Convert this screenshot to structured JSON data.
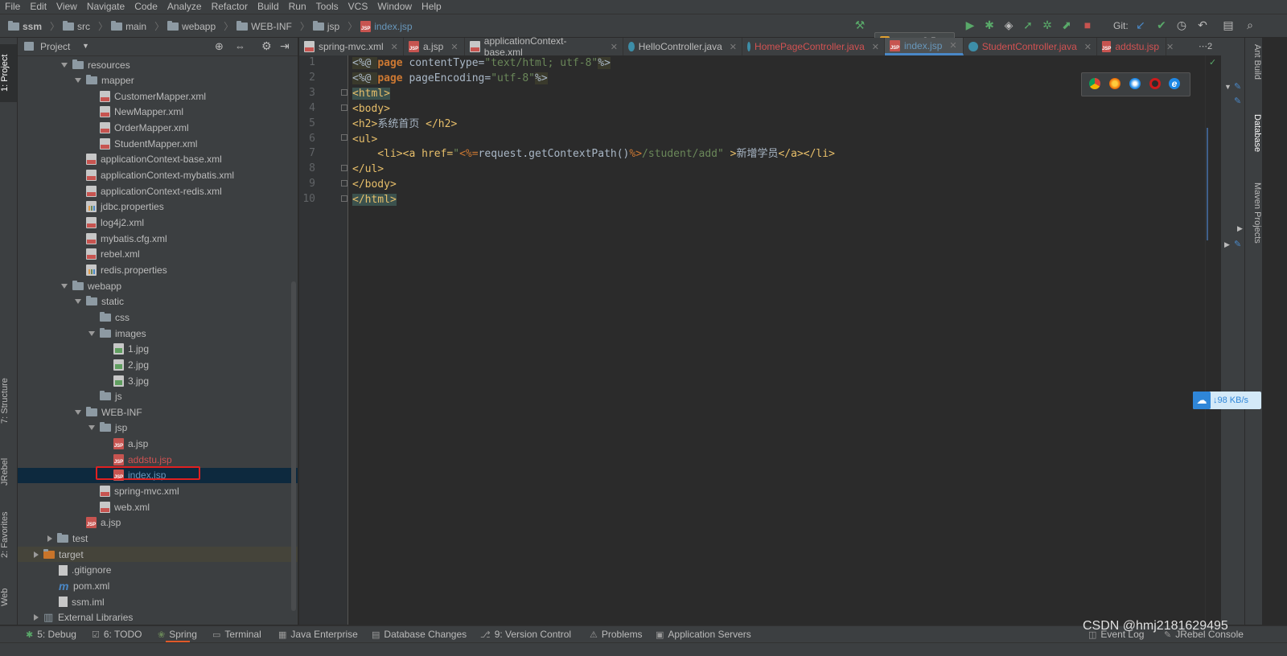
{
  "menu": [
    "File",
    "Edit",
    "View",
    "Navigate",
    "Code",
    "Analyze",
    "Refactor",
    "Build",
    "Run",
    "Tools",
    "VCS",
    "Window",
    "Help"
  ],
  "breadcrumb": [
    "ssm",
    "src",
    "main",
    "webapp",
    "WEB-INF",
    "jsp",
    "index.jsp"
  ],
  "toolbar": {
    "run_config": "tomcat8.5",
    "git_label": "Git:"
  },
  "project_panel": {
    "title": "Project"
  },
  "tree": [
    {
      "label": "resources",
      "depth": 2,
      "icon": "folder",
      "arrow": "down"
    },
    {
      "label": "mapper",
      "depth": 3,
      "icon": "folder",
      "arrow": "down"
    },
    {
      "label": "CustomerMapper.xml",
      "depth": 4,
      "icon": "xml"
    },
    {
      "label": "NewMapper.xml",
      "depth": 4,
      "icon": "xml"
    },
    {
      "label": "OrderMapper.xml",
      "depth": 4,
      "icon": "xml"
    },
    {
      "label": "StudentMapper.xml",
      "depth": 4,
      "icon": "xml"
    },
    {
      "label": "applicationContext-base.xml",
      "depth": 3,
      "icon": "xml"
    },
    {
      "label": "applicationContext-mybatis.xml",
      "depth": 3,
      "icon": "xml"
    },
    {
      "label": "applicationContext-redis.xml",
      "depth": 3,
      "icon": "xml"
    },
    {
      "label": "jdbc.properties",
      "depth": 3,
      "icon": "prop"
    },
    {
      "label": "log4j2.xml",
      "depth": 3,
      "icon": "xml"
    },
    {
      "label": "mybatis.cfg.xml",
      "depth": 3,
      "icon": "xml"
    },
    {
      "label": "rebel.xml",
      "depth": 3,
      "icon": "xml"
    },
    {
      "label": "redis.properties",
      "depth": 3,
      "icon": "prop"
    },
    {
      "label": "webapp",
      "depth": 2,
      "icon": "folder",
      "arrow": "down"
    },
    {
      "label": "static",
      "depth": 3,
      "icon": "folder",
      "arrow": "down"
    },
    {
      "label": "css",
      "depth": 4,
      "icon": "folder"
    },
    {
      "label": "images",
      "depth": 4,
      "icon": "folder",
      "arrow": "down"
    },
    {
      "label": "1.jpg",
      "depth": 5,
      "icon": "img"
    },
    {
      "label": "2.jpg",
      "depth": 5,
      "icon": "img"
    },
    {
      "label": "3.jpg",
      "depth": 5,
      "icon": "img"
    },
    {
      "label": "js",
      "depth": 4,
      "icon": "folder"
    },
    {
      "label": "WEB-INF",
      "depth": 3,
      "icon": "folder",
      "arrow": "down"
    },
    {
      "label": "jsp",
      "depth": 4,
      "icon": "folder",
      "arrow": "down"
    },
    {
      "label": "a.jsp",
      "depth": 5,
      "icon": "jsp"
    },
    {
      "label": "addstu.jsp",
      "depth": 5,
      "icon": "jsp",
      "color": "#d25252"
    },
    {
      "label": "index.jsp",
      "depth": 5,
      "icon": "jsp",
      "color": "#6897bb",
      "selected": true
    },
    {
      "label": "spring-mvc.xml",
      "depth": 4,
      "icon": "xml"
    },
    {
      "label": "web.xml",
      "depth": 4,
      "icon": "xml"
    },
    {
      "label": "a.jsp",
      "depth": 3,
      "icon": "jsp"
    },
    {
      "label": "test",
      "depth": 1,
      "icon": "folder",
      "arrow": "right"
    },
    {
      "label": "target",
      "depth": 0,
      "icon": "folder-orange",
      "arrow": "right",
      "target": true
    },
    {
      "label": ".gitignore",
      "depth": 1,
      "icon": "file"
    },
    {
      "label": "pom.xml",
      "depth": 1,
      "icon": "maven"
    },
    {
      "label": "ssm.iml",
      "depth": 1,
      "icon": "file"
    },
    {
      "label": "External Libraries",
      "depth": 0,
      "icon": "lib",
      "arrow": "right"
    }
  ],
  "tabs": [
    {
      "label": "spring-mvc.xml",
      "icon": "xml"
    },
    {
      "label": "a.jsp",
      "icon": "jsp"
    },
    {
      "label": "applicationContext-base.xml",
      "icon": "xml"
    },
    {
      "label": "HelloController.java",
      "icon": "class"
    },
    {
      "label": "HomePageController.java",
      "icon": "class",
      "color": "#d25252"
    },
    {
      "label": "index.jsp",
      "icon": "jsp",
      "active": true,
      "color": "#6897bb"
    },
    {
      "label": "StudentController.java",
      "icon": "class",
      "color": "#d25252"
    },
    {
      "label": "addstu.jsp",
      "icon": "jsp",
      "color": "#d25252"
    }
  ],
  "tab_overflow": "⋯2",
  "line_numbers": [
    "1",
    "2",
    "3",
    "4",
    "5",
    "6",
    "7",
    "8",
    "9",
    "10"
  ],
  "code": {
    "l1": [
      "<%@ ",
      "page",
      " contentType=",
      "\"text/html; utf-8\"",
      "%>"
    ],
    "l2": [
      "<%@ ",
      "page",
      " pageEncoding=",
      "\"utf-8\"",
      "%>"
    ],
    "l3": "<html>",
    "l4": "<body>",
    "l5": [
      "<h2>",
      "系统首页 ",
      "</h2>"
    ],
    "l6": "<ul>",
    "l7": [
      "    <li><a href=",
      "\"",
      "<%=",
      "request.getContextPath()",
      "%>",
      "/student/add\"",
      " >",
      "新增学员",
      "</a></li>"
    ],
    "l8": "</ul>",
    "l9": "</body>",
    "l10": "</html>"
  },
  "left_tabs": [
    "1: Project",
    "7: Structure",
    "JRebel",
    "2: Favorites",
    "Web"
  ],
  "right_tabs": [
    "Ant Build",
    "Database",
    "Maven Projects"
  ],
  "net_speed": "98 KB/s",
  "bottom_tabs": [
    "5: Debug",
    "6: TODO",
    "Spring",
    "Terminal",
    "Java Enterprise",
    "Database Changes",
    "9: Version Control",
    "Problems",
    "Application Servers",
    "Event Log",
    "JRebel Console"
  ],
  "watermark": "CSDN @hmj2181629495"
}
